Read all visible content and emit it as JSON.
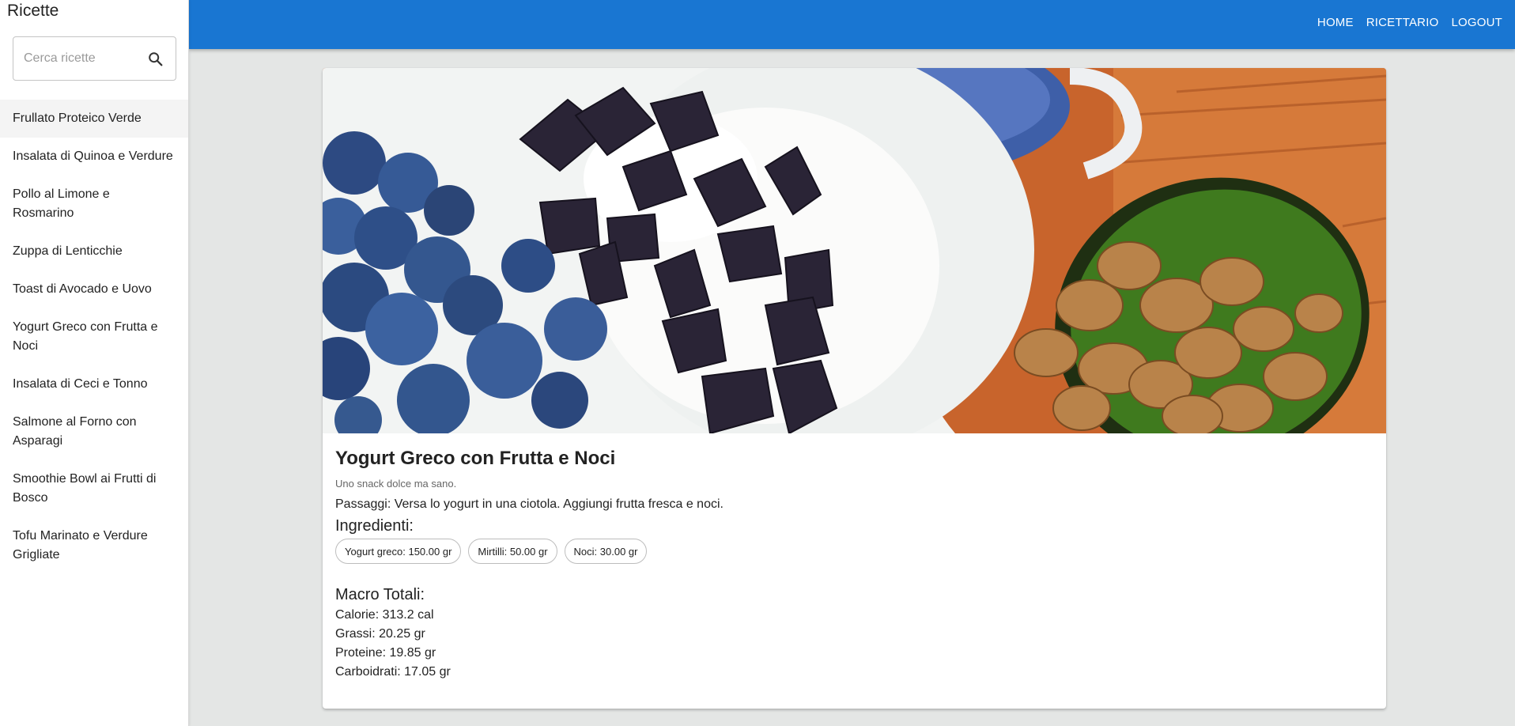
{
  "sidebar": {
    "title": "Ricette",
    "search": {
      "placeholder": "Cerca ricette",
      "value": ""
    },
    "items": [
      {
        "label": "Frullato Proteico Verde",
        "active": true
      },
      {
        "label": "Insalata di Quinoa e Verdure"
      },
      {
        "label": "Pollo al Limone e Rosmarino"
      },
      {
        "label": "Zuppa di Lenticchie"
      },
      {
        "label": "Toast di Avocado e Uovo"
      },
      {
        "label": "Yogurt Greco con Frutta e Noci"
      },
      {
        "label": "Insalata di Ceci e Tonno"
      },
      {
        "label": "Salmone al Forno con Asparagi"
      },
      {
        "label": "Smoothie Bowl ai Frutti di Bosco"
      },
      {
        "label": "Tofu Marinato e Verdure Grigliate"
      }
    ]
  },
  "topbar": {
    "nav": [
      "HOME",
      "RICETTARIO",
      "LOGOUT"
    ]
  },
  "recipe": {
    "title": "Yogurt Greco con Frutta e Noci",
    "subtitle": "Uno snack dolce ma sano.",
    "steps": "Passaggi: Versa lo yogurt in una ciotola. Aggiungi frutta fresca e noci.",
    "ingredients_title": "Ingredienti:",
    "ingredients": [
      "Yogurt greco: 150.00 gr",
      "Mirtilli: 50.00 gr",
      "Noci: 30.00 gr"
    ],
    "macro_title": "Macro Totali:",
    "macros": {
      "calorie": "Calorie: 313.2 cal",
      "grassi": "Grassi: 20.25 gr",
      "proteine": "Proteine: 19.85 gr",
      "carboidrati": "Carboidrati: 17.05 gr"
    }
  },
  "colors": {
    "topbar": "#1976d2",
    "background": "#e4e6e5",
    "active_item": "#f4f4f4"
  }
}
